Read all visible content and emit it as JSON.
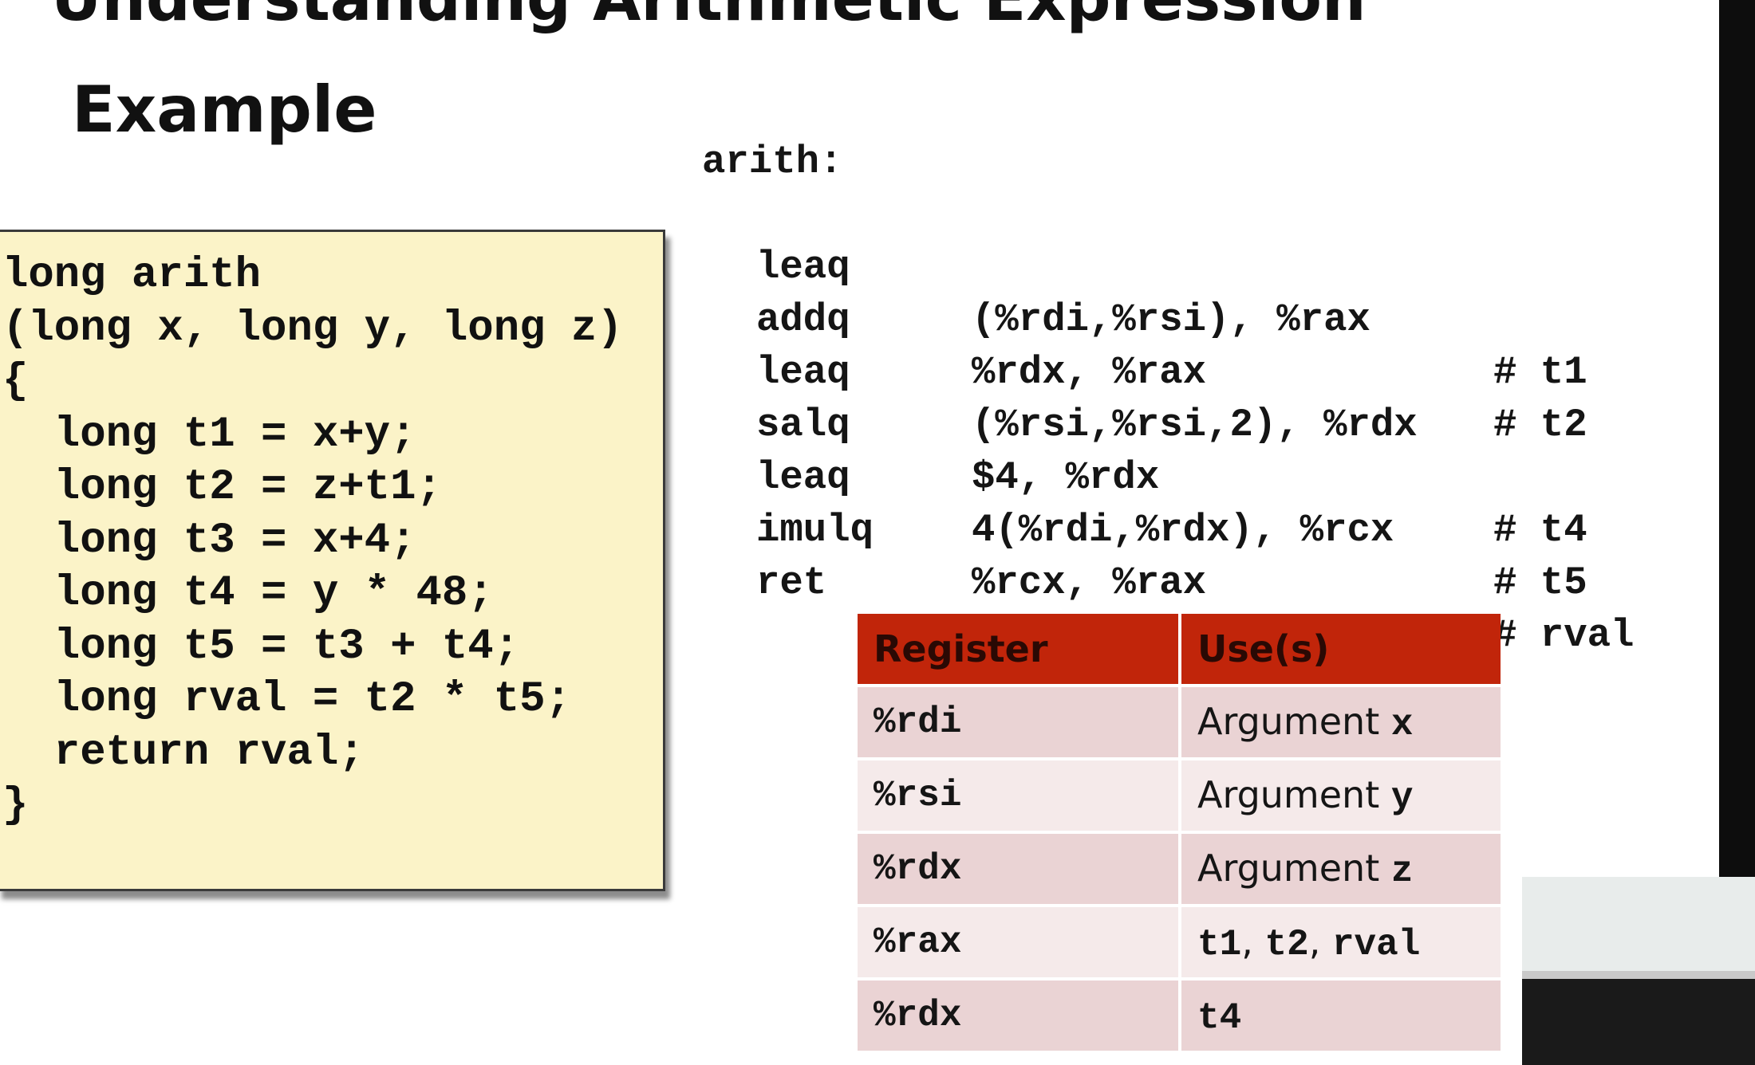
{
  "slide": {
    "title": "Understanding Arithmetic Expression",
    "subtitle": "Example"
  },
  "c_code": {
    "lines": [
      "long arith",
      "(long x, long y, long z)",
      "{",
      "  long t1 = x+y;",
      "  long t2 = z+t1;",
      "  long t3 = x+4;",
      "  long t4 = y * 48;",
      "  long t5 = t3 + t4;",
      "  long rval = t2 * t5;",
      "  return rval;",
      "}"
    ]
  },
  "assembly": {
    "label": "arith:",
    "rows": [
      {
        "op": "leaq",
        "args": "(%rdi,%rsi), %rax",
        "comment": "# t1"
      },
      {
        "op": "addq",
        "args": "%rdx, %rax",
        "comment": "# t2"
      },
      {
        "op": "leaq",
        "args": "(%rsi,%rsi,2), %rdx",
        "comment": ""
      },
      {
        "op": "salq",
        "args": "$4, %rdx",
        "comment": "# t4"
      },
      {
        "op": "leaq",
        "args": "4(%rdi,%rdx), %rcx",
        "comment": "# t5"
      },
      {
        "op": "imulq",
        "args": "%rcx, %rax",
        "comment": "# rval"
      },
      {
        "op": "ret",
        "args": "",
        "comment": ""
      }
    ]
  },
  "register_table": {
    "headers": [
      "Register",
      "Use(s)"
    ],
    "rows": [
      {
        "register": "%rdi",
        "use_text": "Argument ",
        "use_var": "x"
      },
      {
        "register": "%rsi",
        "use_text": "Argument ",
        "use_var": "y"
      },
      {
        "register": "%rdx",
        "use_text": "Argument ",
        "use_var": "z"
      },
      {
        "register": "%rax",
        "use_a": "t1",
        "sep1": ", ",
        "use_b": "t2",
        "sep2": ", ",
        "use_c": "rval"
      },
      {
        "register": "%rdx",
        "use_mono": "t4"
      }
    ],
    "colors": {
      "header_bg": "#c1250a",
      "row_odd": "#ead3d4",
      "row_even": "#f5eaea"
    }
  }
}
